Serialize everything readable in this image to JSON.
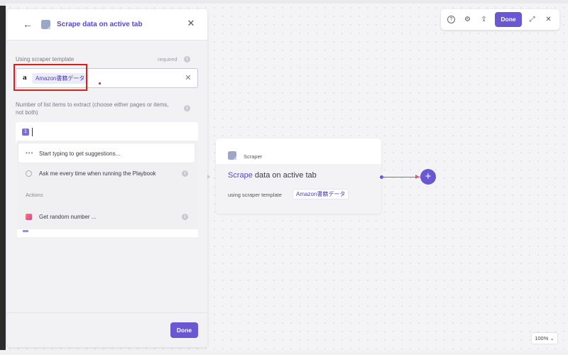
{
  "panel": {
    "title": "Scrape data on active tab",
    "template_label": "Using scraper template",
    "required_label": "required",
    "template_value": "Amazon書籍データ",
    "count_label": "Number of list items to extract (choose either pages or items, not both)",
    "count_badge": "1",
    "suggestions": {
      "hint": "Start typing to get suggestions...",
      "ask_me": "Ask me every time when running the Playbook",
      "actions_label": "Actions",
      "random_number": "Get random number ..."
    },
    "done_label": "Done"
  },
  "node": {
    "kind": "Scraper",
    "title_accent": "Scrape",
    "title_rest": " data on active tab",
    "sub_label": "using scraper template",
    "chip": "Amazon書籍データ"
  },
  "toolbar": {
    "done_label": "Done"
  },
  "zoom": {
    "value": "100%"
  },
  "colors": {
    "accent": "#6a58d3",
    "highlight": "#e21b1b"
  }
}
